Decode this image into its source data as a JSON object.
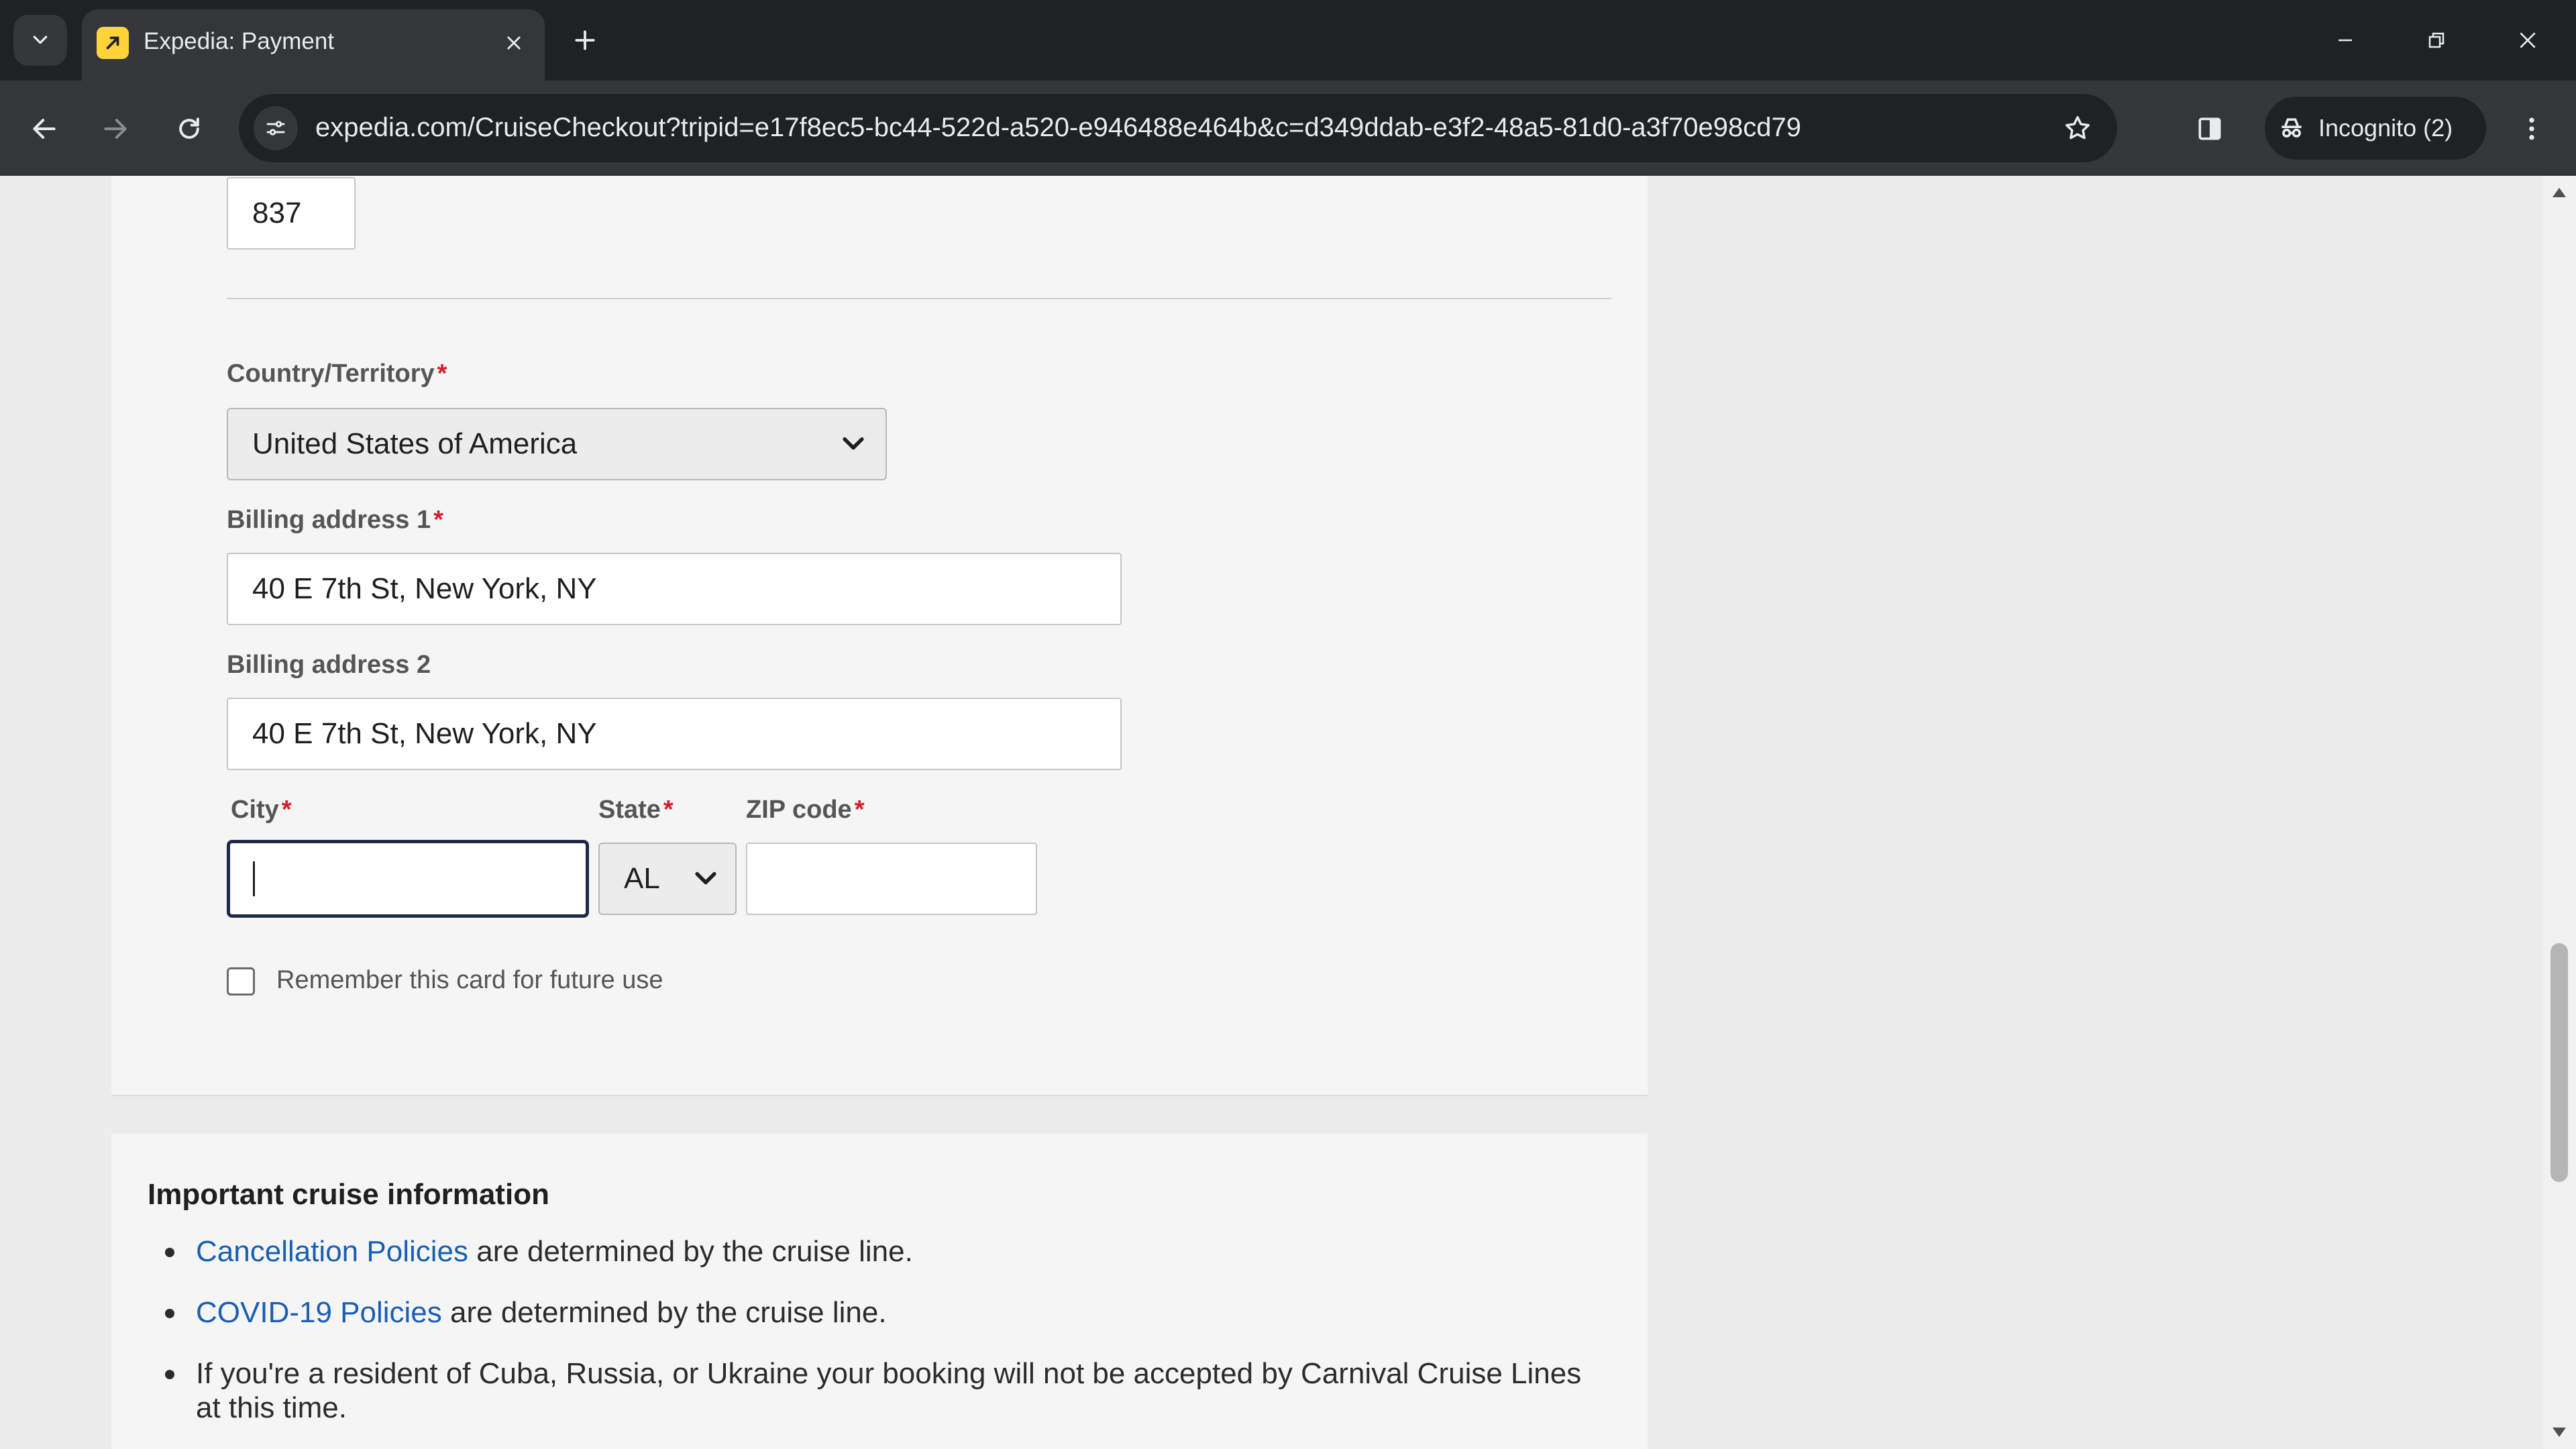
{
  "browser": {
    "tab": {
      "title": "Expedia: Payment",
      "favicon": "expedia-favicon-icon"
    },
    "url": "expedia.com/CruiseCheckout?tripid=e17f8ec5-bc44-522d-a520-e946488e464b&c=d349ddab-e3f2-48a5-81d0-a3f70e98cd79",
    "incognito_label": "Incognito (2)"
  },
  "form": {
    "security_code_value": "837",
    "country": {
      "label": "Country/Territory",
      "required_mark": "*",
      "value": "United States of America"
    },
    "billing_address_1": {
      "label": "Billing address 1",
      "required_mark": "*",
      "value": "40 E 7th St, New York, NY"
    },
    "billing_address_2": {
      "label": "Billing address 2",
      "value": "40 E 7th St, New York, NY"
    },
    "city": {
      "label": "City",
      "required_mark": "*",
      "value": ""
    },
    "state": {
      "label": "State",
      "required_mark": "*",
      "value": "AL"
    },
    "zip": {
      "label": "ZIP code",
      "required_mark": "*",
      "value": ""
    },
    "remember_card_label": "Remember this card for future use"
  },
  "cruise_info": {
    "title": "Important cruise information",
    "items": [
      {
        "link": "Cancellation Policies",
        "text": " are determined by the cruise line."
      },
      {
        "link": "COVID-19 Policies",
        "text": " are determined by the cruise line."
      },
      {
        "link": "",
        "text": "If you're a resident of Cuba, Russia, or Ukraine your booking will not be accepted by Carnival Cruise Lines at this time."
      }
    ]
  },
  "colors": {
    "link": "#1a5fb4",
    "required": "#d3202a",
    "chrome_dark": "#202124",
    "chrome_toolbar": "#35363a"
  }
}
